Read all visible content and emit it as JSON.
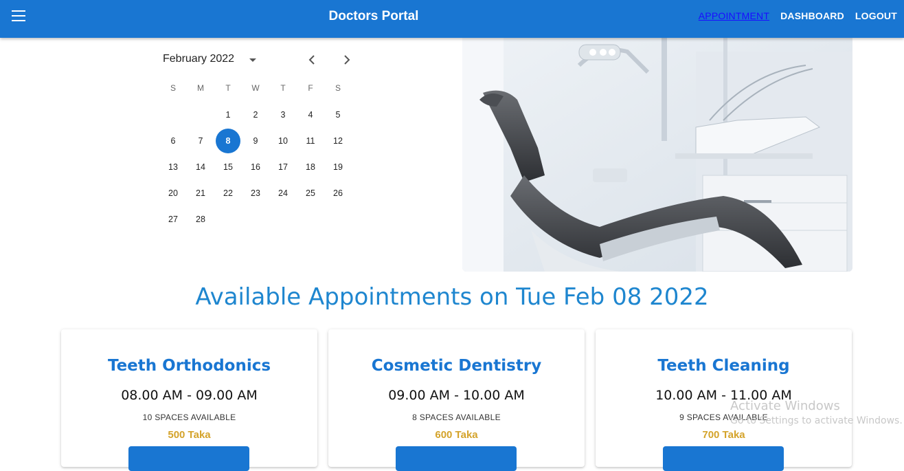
{
  "header": {
    "title": "Doctors Portal",
    "nav": [
      "APPOINTMENT",
      "DASHBOARD",
      "LOGOUT"
    ],
    "active_nav": "APPOINTMENT",
    "color": "#1976d2"
  },
  "calendar": {
    "month_label": "February 2022",
    "weekdays": [
      "S",
      "M",
      "T",
      "W",
      "T",
      "F",
      "S"
    ],
    "weeks": [
      [
        "",
        "",
        "1",
        "2",
        "3",
        "4",
        "5"
      ],
      [
        "6",
        "7",
        "8",
        "9",
        "10",
        "11",
        "12"
      ],
      [
        "13",
        "14",
        "15",
        "16",
        "17",
        "18",
        "19"
      ],
      [
        "20",
        "21",
        "22",
        "23",
        "24",
        "25",
        "26"
      ],
      [
        "27",
        "28",
        "",
        "",
        "",
        "",
        ""
      ]
    ],
    "selected_day": "8"
  },
  "hero": {
    "image": "dental-chair-clinic"
  },
  "section": {
    "title": "Available Appointments on Tue Feb 08 2022"
  },
  "appointments": [
    {
      "name": "Teeth Orthodonics",
      "time": "08.00 AM - 09.00 AM",
      "spaces": "10 SPACES AVAILABLE",
      "price": "500 Taka"
    },
    {
      "name": "Cosmetic Dentistry",
      "time": "09.00 AM - 10.00 AM",
      "spaces": "8 SPACES AVAILABLE",
      "price": "600 Taka"
    },
    {
      "name": "Teeth Cleaning",
      "time": "10.00 AM - 11.00 AM",
      "spaces": "9 SPACES AVAILABLE",
      "price": "700 Taka"
    }
  ],
  "watermark": {
    "title": "Activate Windows",
    "subtitle": "Go to Settings to activate Windows."
  }
}
